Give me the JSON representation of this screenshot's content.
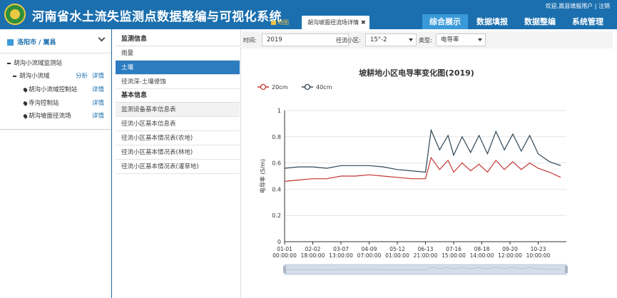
{
  "header": {
    "app_title": "河南省水土流失监测点数据整编与可视化系统",
    "user_welcome": "欢迎,嵩县填报用户",
    "logout": "注销",
    "tabs": [
      {
        "label": "地图"
      },
      {
        "label": "胡沟坡面径流场详情",
        "close": "✖"
      }
    ],
    "nav": [
      "综合展示",
      "数据填报",
      "数据整编",
      "系统管理"
    ],
    "colors": {
      "header_bg": "#1b6fae",
      "nav_active": "#3a9ad9"
    }
  },
  "left_panel": {
    "region": "洛阳市 / 嵩县",
    "tree": [
      {
        "label": "胡沟小流域监测站"
      },
      {
        "label": "胡沟小流域",
        "links": [
          "分析",
          "详情"
        ]
      },
      {
        "label": "胡沟小流域控制站",
        "links": [
          "详情"
        ]
      },
      {
        "label": "寺沟控制站",
        "links": [
          "详情"
        ]
      },
      {
        "label": "胡沟坡面径流场",
        "links": [
          "详情"
        ]
      }
    ]
  },
  "menu": {
    "section1": "监测信息",
    "items1": [
      "雨量",
      "土壤",
      "径流深-土壤侵蚀"
    ],
    "section2": "基本信息",
    "items2": [
      "监测设备基本信息表",
      "径流小区基本信息表",
      "径流小区基本情况表(农地)",
      "径流小区基本情况表(林地)",
      "径流小区基本情况表(灌草地)"
    ],
    "active_item": "土壤"
  },
  "filter": {
    "time_label": "时间:",
    "time_value": "2019",
    "plot_label": "径流小区:",
    "plot_value": "15°-2",
    "type_label": "类型:",
    "type_value": "电导率"
  },
  "chart_data": {
    "type": "line",
    "title": "坡耕地小区电导率变化图(2019)",
    "ylabel": "电导率 (S/m)",
    "xlabel": "",
    "ylim": [
      0,
      1
    ],
    "yticks": [
      "0",
      "0.2",
      "0.4",
      "0.6",
      "0.8",
      "1"
    ],
    "grid": true,
    "legend_position": "top-left",
    "x_ticks": [
      {
        "date": "01-01",
        "time": "00:00:00"
      },
      {
        "date": "02-02",
        "time": "18:00:00"
      },
      {
        "date": "03-07",
        "time": "13:00:00"
      },
      {
        "date": "04-09",
        "time": "07:00:00"
      },
      {
        "date": "05-12",
        "time": "01:00:00"
      },
      {
        "date": "06-13",
        "time": "21:00:00"
      },
      {
        "date": "07-16",
        "time": "15:00:00"
      },
      {
        "date": "08-18",
        "time": "14:00:00"
      },
      {
        "date": "09-20",
        "time": "12:00:00"
      },
      {
        "date": "10-23",
        "time": "10:00:00"
      }
    ],
    "x_index": [
      0,
      0.5,
      1,
      1.5,
      2,
      2.5,
      3,
      3.5,
      4,
      4.5,
      5,
      5.2,
      5.5,
      5.8,
      6,
      6.3,
      6.6,
      6.9,
      7.2,
      7.5,
      7.8,
      8.1,
      8.4,
      8.7,
      9,
      9.4,
      9.8
    ],
    "series": [
      {
        "name": "20cm",
        "color": "#c23531",
        "values": [
          0.46,
          0.47,
          0.48,
          0.48,
          0.5,
          0.5,
          0.51,
          0.5,
          0.49,
          0.48,
          0.48,
          0.64,
          0.55,
          0.62,
          0.53,
          0.6,
          0.54,
          0.59,
          0.53,
          0.62,
          0.55,
          0.61,
          0.55,
          0.6,
          0.56,
          0.53,
          0.49
        ]
      },
      {
        "name": "40cm",
        "color": "#2f4554",
        "values": [
          0.56,
          0.57,
          0.57,
          0.56,
          0.58,
          0.58,
          0.58,
          0.57,
          0.55,
          0.54,
          0.53,
          0.85,
          0.7,
          0.81,
          0.66,
          0.8,
          0.68,
          0.81,
          0.67,
          0.84,
          0.7,
          0.82,
          0.69,
          0.81,
          0.67,
          0.61,
          0.58
        ]
      }
    ],
    "zoom_range": [
      0,
      1
    ]
  }
}
